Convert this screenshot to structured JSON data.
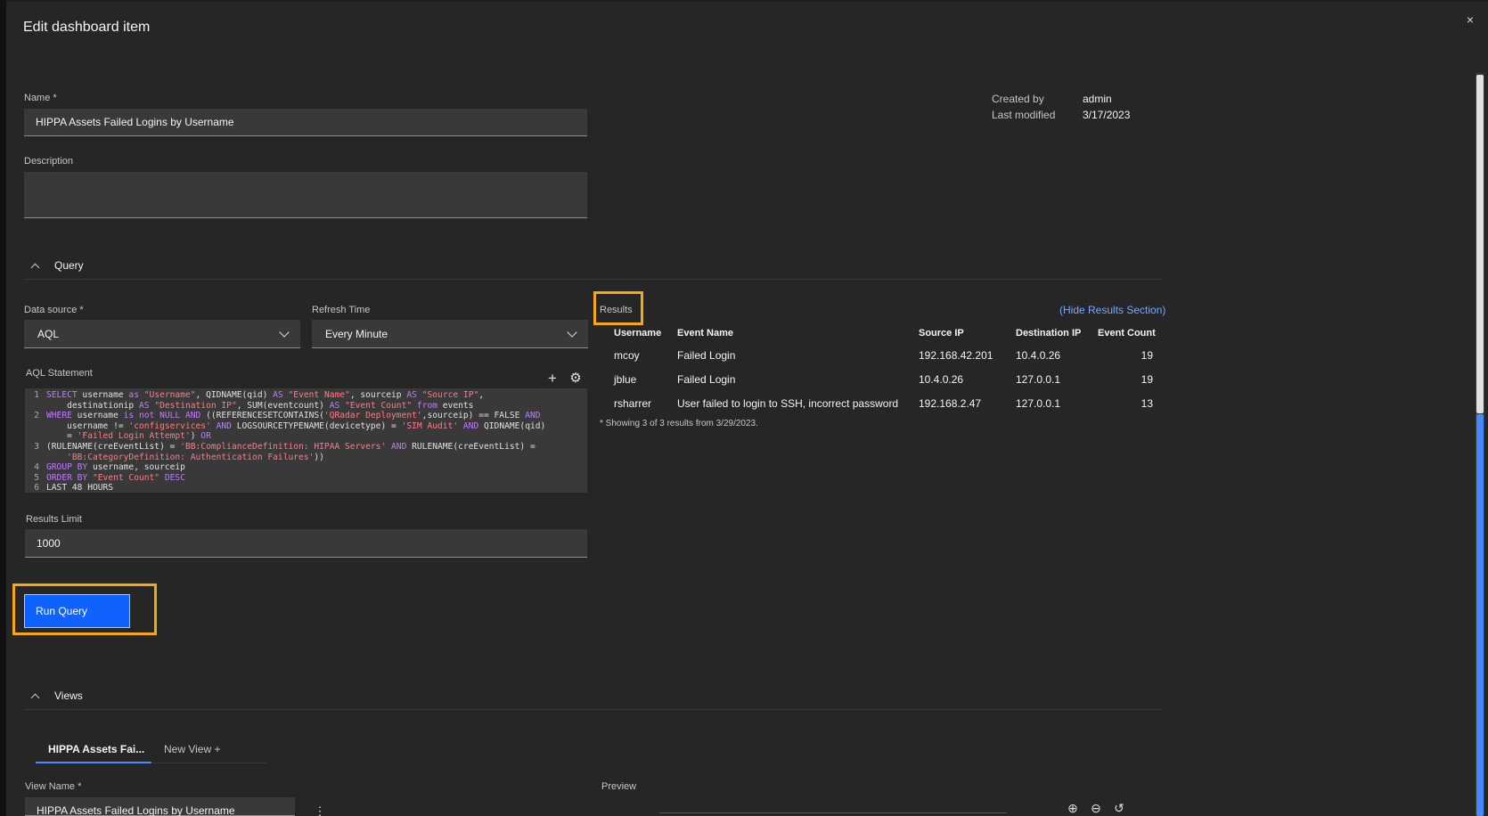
{
  "modal": {
    "title": "Edit dashboard item",
    "close_icon": "close-icon",
    "close_glyph": "×"
  },
  "name": {
    "label": "Name *",
    "value": "HIPPA Assets Failed Logins by Username"
  },
  "description": {
    "label": "Description",
    "value": ""
  },
  "meta": {
    "created_by_label": "Created by",
    "created_by_value": "admin",
    "last_modified_label": "Last modified",
    "last_modified_value": "3/17/2023"
  },
  "query_section": {
    "label": "Query"
  },
  "data_source": {
    "label": "Data source *",
    "value": "AQL"
  },
  "refresh_time": {
    "label": "Refresh Time",
    "value": "Every Minute"
  },
  "aql": {
    "label": "AQL Statement",
    "add_glyph": "+",
    "settings_glyph": "⚙",
    "lines": [
      {
        "n": "1",
        "text": "SELECT username as \"Username\", QIDNAME(qid) AS \"Event Name\", sourceip AS \"Source IP\","
      },
      {
        "n": "",
        "text": "    destinationip AS \"Destination IP\", SUM(eventcount) AS \"Event Count\" from events"
      },
      {
        "n": "2",
        "text": "WHERE username is not NULL AND ((REFERENCESETCONTAINS('QRadar Deployment',sourceip) == FALSE AND"
      },
      {
        "n": "",
        "text": "    username != 'configservices' AND LOGSOURCETYPENAME(devicetype) = 'SIM Audit' AND QIDNAME(qid)"
      },
      {
        "n": "",
        "text": "    = 'Failed Login Attempt') OR"
      },
      {
        "n": "3",
        "text": "(RULENAME(creEventList) = 'BB:ComplianceDefinition: HIPAA Servers' AND RULENAME(creEventList) ="
      },
      {
        "n": "",
        "text": "    'BB:CategoryDefinition: Authentication Failures'))"
      },
      {
        "n": "4",
        "text": "GROUP BY username, sourceip"
      },
      {
        "n": "5",
        "text": "ORDER BY \"Event Count\" DESC"
      },
      {
        "n": "6",
        "text": "LAST 48 HOURS"
      }
    ]
  },
  "results_limit": {
    "label": "Results Limit",
    "value": "1000"
  },
  "run_query": {
    "label": "Run Query"
  },
  "results": {
    "label": "Results",
    "hide_link": "(Hide Results Section)",
    "columns": [
      "Username",
      "Event Name",
      "Source IP",
      "Destination IP",
      "Event Count"
    ],
    "rows": [
      [
        "mcoy",
        "Failed Login",
        "192.168.42.201",
        "10.4.0.26",
        "19"
      ],
      [
        "jblue",
        "Failed Login",
        "10.4.0.26",
        "127.0.0.1",
        "19"
      ],
      [
        "rsharrer",
        "User failed to login to SSH, incorrect password",
        "192.168.2.47",
        "127.0.0.1",
        "13"
      ]
    ],
    "footnote": "* Showing 3 of 3 results from 3/29/2023."
  },
  "views_section": {
    "label": "Views"
  },
  "view_tabs": [
    {
      "label": "HIPPA Assets Fai..."
    },
    {
      "label": "New View +"
    }
  ],
  "view_name": {
    "label": "View Name *",
    "value": "HIPPA Assets Failed Logins by Username",
    "overflow_glyph": "⋮"
  },
  "preview": {
    "label": "Preview",
    "zoom_in_glyph": "⊕",
    "zoom_out_glyph": "⊖",
    "reset_glyph": "↺"
  },
  "colors": {
    "accent": "#0f62fe",
    "highlight": "#f7a70f",
    "link": "#78a9ff"
  }
}
